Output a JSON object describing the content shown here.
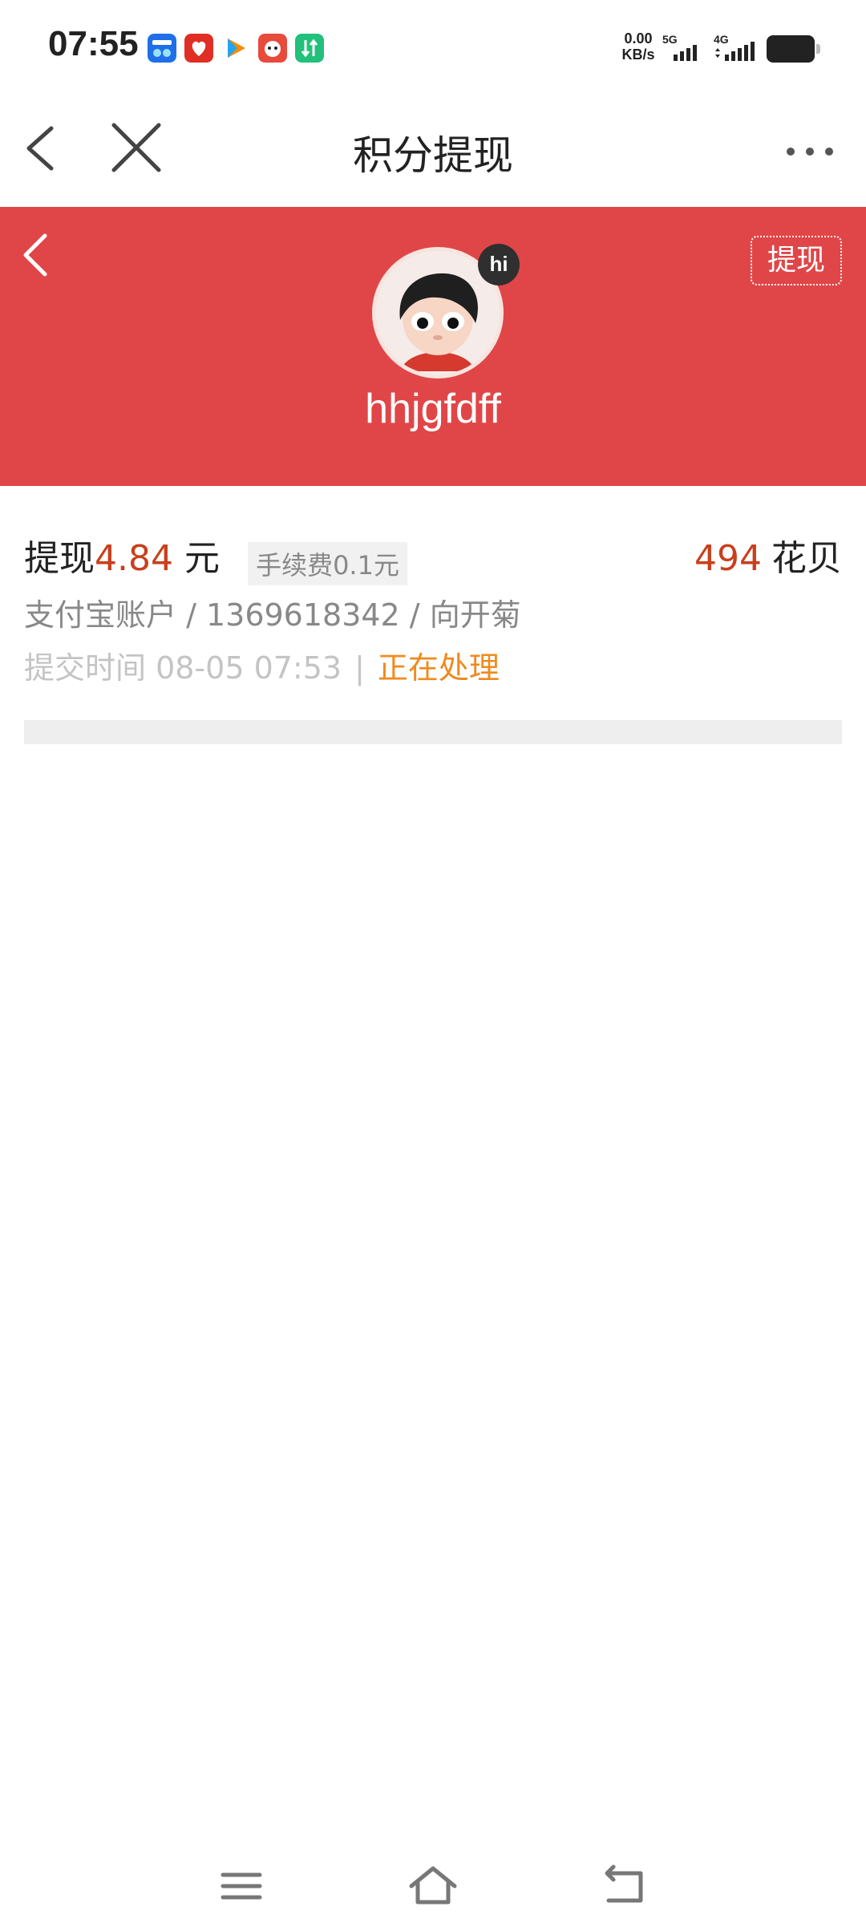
{
  "status_bar": {
    "time": "07:55",
    "net_speed_value": "0.00",
    "net_speed_unit": "KB/s",
    "signal_1": "5G",
    "signal_2": "4G",
    "app_icons": [
      "qiche-icon",
      "pinduoduo-icon",
      "tencent-video-icon",
      "game-icon",
      "transfer-icon"
    ]
  },
  "title_bar": {
    "title": "积分提现",
    "back_icon": "chevron-left-icon",
    "close_icon": "close-icon",
    "more_icon": "more-icon"
  },
  "profile": {
    "username": "hhjgfdff",
    "badge": "hi",
    "withdraw_button": "提现",
    "header_color": "#e04648"
  },
  "record": {
    "withdraw_label": "提现",
    "amount": "4.84",
    "unit": "元",
    "fee": "手续费0.1元",
    "points_value": "494",
    "points_label": "花贝",
    "account": "支付宝账户 / 1369618342 / 向开菊",
    "submit_time": "提交时间 08-05 07:53",
    "separator": "|",
    "status": "正在处理",
    "accent_color": "#c8401c",
    "status_color": "#f08a1e"
  },
  "bottom_nav": {
    "items": [
      "menu-icon",
      "home-icon",
      "back-icon"
    ]
  }
}
